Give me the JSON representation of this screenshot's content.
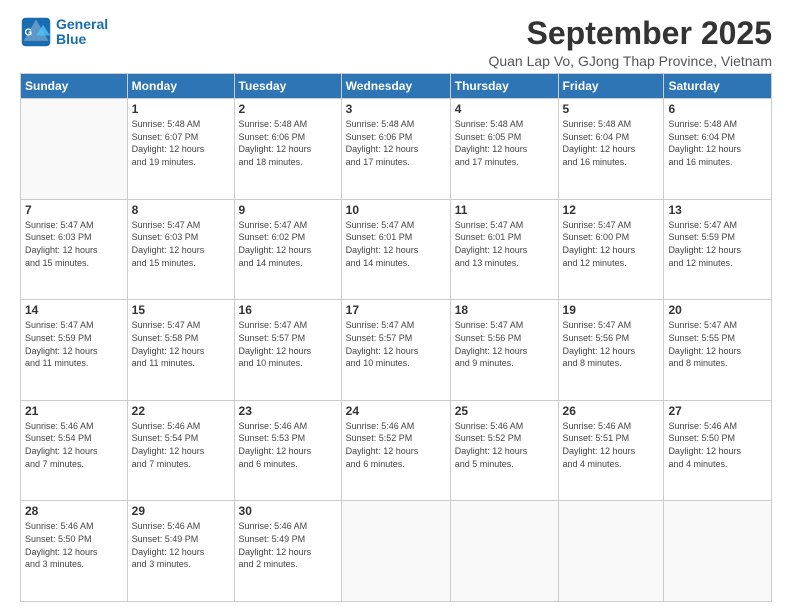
{
  "logo": {
    "line1": "General",
    "line2": "Blue"
  },
  "title": "September 2025",
  "subtitle": "Quan Lap Vo, GJong Thap Province, Vietnam",
  "days_of_week": [
    "Sunday",
    "Monday",
    "Tuesday",
    "Wednesday",
    "Thursday",
    "Friday",
    "Saturday"
  ],
  "weeks": [
    [
      {
        "day": "",
        "info": ""
      },
      {
        "day": "1",
        "info": "Sunrise: 5:48 AM\nSunset: 6:07 PM\nDaylight: 12 hours\nand 19 minutes."
      },
      {
        "day": "2",
        "info": "Sunrise: 5:48 AM\nSunset: 6:06 PM\nDaylight: 12 hours\nand 18 minutes."
      },
      {
        "day": "3",
        "info": "Sunrise: 5:48 AM\nSunset: 6:06 PM\nDaylight: 12 hours\nand 17 minutes."
      },
      {
        "day": "4",
        "info": "Sunrise: 5:48 AM\nSunset: 6:05 PM\nDaylight: 12 hours\nand 17 minutes."
      },
      {
        "day": "5",
        "info": "Sunrise: 5:48 AM\nSunset: 6:04 PM\nDaylight: 12 hours\nand 16 minutes."
      },
      {
        "day": "6",
        "info": "Sunrise: 5:48 AM\nSunset: 6:04 PM\nDaylight: 12 hours\nand 16 minutes."
      }
    ],
    [
      {
        "day": "7",
        "info": "Sunrise: 5:47 AM\nSunset: 6:03 PM\nDaylight: 12 hours\nand 15 minutes."
      },
      {
        "day": "8",
        "info": "Sunrise: 5:47 AM\nSunset: 6:03 PM\nDaylight: 12 hours\nand 15 minutes."
      },
      {
        "day": "9",
        "info": "Sunrise: 5:47 AM\nSunset: 6:02 PM\nDaylight: 12 hours\nand 14 minutes."
      },
      {
        "day": "10",
        "info": "Sunrise: 5:47 AM\nSunset: 6:01 PM\nDaylight: 12 hours\nand 14 minutes."
      },
      {
        "day": "11",
        "info": "Sunrise: 5:47 AM\nSunset: 6:01 PM\nDaylight: 12 hours\nand 13 minutes."
      },
      {
        "day": "12",
        "info": "Sunrise: 5:47 AM\nSunset: 6:00 PM\nDaylight: 12 hours\nand 12 minutes."
      },
      {
        "day": "13",
        "info": "Sunrise: 5:47 AM\nSunset: 5:59 PM\nDaylight: 12 hours\nand 12 minutes."
      }
    ],
    [
      {
        "day": "14",
        "info": "Sunrise: 5:47 AM\nSunset: 5:59 PM\nDaylight: 12 hours\nand 11 minutes."
      },
      {
        "day": "15",
        "info": "Sunrise: 5:47 AM\nSunset: 5:58 PM\nDaylight: 12 hours\nand 11 minutes."
      },
      {
        "day": "16",
        "info": "Sunrise: 5:47 AM\nSunset: 5:57 PM\nDaylight: 12 hours\nand 10 minutes."
      },
      {
        "day": "17",
        "info": "Sunrise: 5:47 AM\nSunset: 5:57 PM\nDaylight: 12 hours\nand 10 minutes."
      },
      {
        "day": "18",
        "info": "Sunrise: 5:47 AM\nSunset: 5:56 PM\nDaylight: 12 hours\nand 9 minutes."
      },
      {
        "day": "19",
        "info": "Sunrise: 5:47 AM\nSunset: 5:56 PM\nDaylight: 12 hours\nand 8 minutes."
      },
      {
        "day": "20",
        "info": "Sunrise: 5:47 AM\nSunset: 5:55 PM\nDaylight: 12 hours\nand 8 minutes."
      }
    ],
    [
      {
        "day": "21",
        "info": "Sunrise: 5:46 AM\nSunset: 5:54 PM\nDaylight: 12 hours\nand 7 minutes."
      },
      {
        "day": "22",
        "info": "Sunrise: 5:46 AM\nSunset: 5:54 PM\nDaylight: 12 hours\nand 7 minutes."
      },
      {
        "day": "23",
        "info": "Sunrise: 5:46 AM\nSunset: 5:53 PM\nDaylight: 12 hours\nand 6 minutes."
      },
      {
        "day": "24",
        "info": "Sunrise: 5:46 AM\nSunset: 5:52 PM\nDaylight: 12 hours\nand 6 minutes."
      },
      {
        "day": "25",
        "info": "Sunrise: 5:46 AM\nSunset: 5:52 PM\nDaylight: 12 hours\nand 5 minutes."
      },
      {
        "day": "26",
        "info": "Sunrise: 5:46 AM\nSunset: 5:51 PM\nDaylight: 12 hours\nand 4 minutes."
      },
      {
        "day": "27",
        "info": "Sunrise: 5:46 AM\nSunset: 5:50 PM\nDaylight: 12 hours\nand 4 minutes."
      }
    ],
    [
      {
        "day": "28",
        "info": "Sunrise: 5:46 AM\nSunset: 5:50 PM\nDaylight: 12 hours\nand 3 minutes."
      },
      {
        "day": "29",
        "info": "Sunrise: 5:46 AM\nSunset: 5:49 PM\nDaylight: 12 hours\nand 3 minutes."
      },
      {
        "day": "30",
        "info": "Sunrise: 5:46 AM\nSunset: 5:49 PM\nDaylight: 12 hours\nand 2 minutes."
      },
      {
        "day": "",
        "info": ""
      },
      {
        "day": "",
        "info": ""
      },
      {
        "day": "",
        "info": ""
      },
      {
        "day": "",
        "info": ""
      }
    ]
  ]
}
